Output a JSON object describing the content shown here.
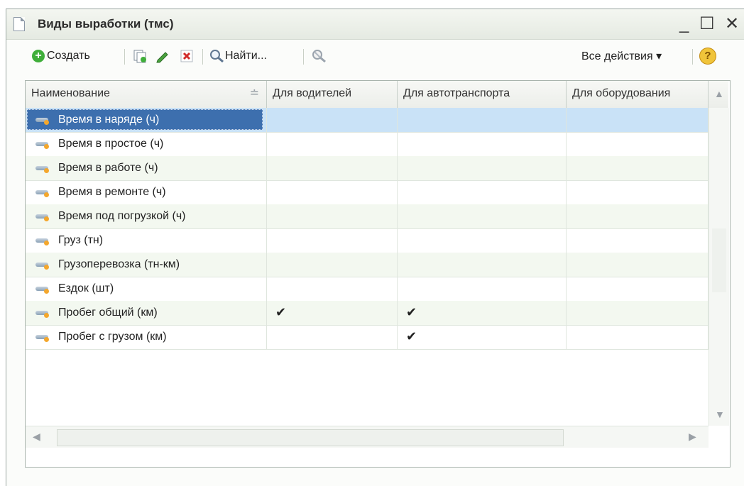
{
  "window": {
    "title": "Виды выработки (тмс)",
    "controls": [
      "_",
      "☐",
      "✕"
    ]
  },
  "toolbar": {
    "create_label": "Создать",
    "find_label": "Найти...",
    "all_actions_label": "Все действия ▾",
    "help_label": "?"
  },
  "table": {
    "columns": [
      "Наименование",
      "Для водителей",
      "Для автотранспорта",
      "Для оборудования"
    ],
    "rows": [
      {
        "name": "Время в наряде (ч)",
        "drivers": "",
        "vehicles": "",
        "equipment": ""
      },
      {
        "name": "Время в простое (ч)",
        "drivers": "",
        "vehicles": "",
        "equipment": ""
      },
      {
        "name": "Время в работе (ч)",
        "drivers": "",
        "vehicles": "",
        "equipment": ""
      },
      {
        "name": "Время в ремонте (ч)",
        "drivers": "",
        "vehicles": "",
        "equipment": ""
      },
      {
        "name": "Время под погрузкой (ч)",
        "drivers": "",
        "vehicles": "",
        "equipment": ""
      },
      {
        "name": "Груз (тн)",
        "drivers": "",
        "vehicles": "",
        "equipment": ""
      },
      {
        "name": "Грузоперевозка (тн-км)",
        "drivers": "",
        "vehicles": "",
        "equipment": ""
      },
      {
        "name": "Ездок (шт)",
        "drivers": "",
        "vehicles": "",
        "equipment": ""
      },
      {
        "name": "Пробег общий (км)",
        "drivers": "✔",
        "vehicles": "✔",
        "equipment": ""
      },
      {
        "name": "Пробег с грузом (км)",
        "drivers": "",
        "vehicles": "✔",
        "equipment": ""
      }
    ]
  }
}
